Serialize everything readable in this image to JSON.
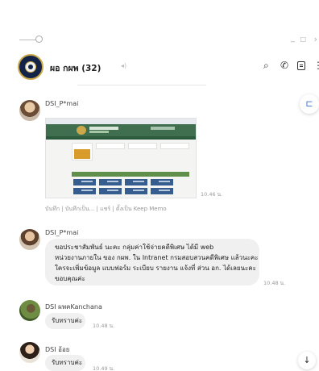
{
  "window": {
    "minimize_glyph": "_",
    "maximize_glyph": "□",
    "close_glyph": "›"
  },
  "header": {
    "group_name": "ผอ กผพ (32)",
    "mute_glyph": "◂)",
    "search_glyph": "⌕",
    "phone_glyph": "✆",
    "more_glyph": "⋮"
  },
  "messages": [
    {
      "sender": "DSI_P*mai",
      "type": "image",
      "time": "10.46 น.",
      "actions": "บันทึก | บันทึกเป็น... | แชร์ | ตั้งเป็น Keep Memo"
    },
    {
      "sender": "DSI_P*mai",
      "type": "text",
      "lines": [
        "ขอประชาสัมพันธ์ นะคะ  กลุ่มค่าใช้จ่ายคดีพิเศษ ได้มี web",
        "หน่วยงานภายใน ของ กผพ. ใน Intranet กรมสอบสวนคดีพิเศษ แล้วนะคะ",
        "ใครจะเพิ่มข้อมูล แบบฟอร์ม ระเบียบ รายงาน แจ้งที่ ส่วน อก. ได้เลยนะคะ",
        "ขอบคุณค่ะ"
      ],
      "time": "10.48 น."
    },
    {
      "sender": "DSI ผพคKanchana",
      "type": "text",
      "text": "รับทราบค่ะ",
      "time": "10.48 น."
    },
    {
      "sender": "DSI อ้อย",
      "type": "text",
      "text": "รับทราบค่ะ",
      "time": "10.49 น."
    }
  ],
  "floating": {
    "memo_glyph": "⊏",
    "scroll_down_glyph": "↓"
  },
  "colors": {
    "bubble": "#f0f0f0",
    "accent_blue": "#3a6fd0",
    "banner_green": "#3f6f4f"
  }
}
